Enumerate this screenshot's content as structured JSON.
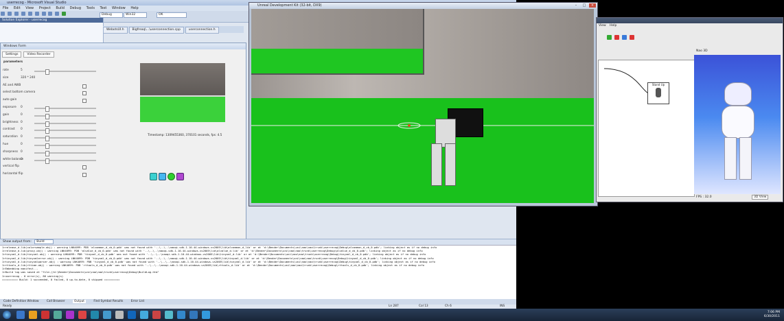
{
  "vs": {
    "title": "userrecog - Microsoft Visual Studio",
    "menu": [
      "File",
      "Edit",
      "View",
      "Project",
      "Build",
      "Debug",
      "Tools",
      "Test",
      "Window",
      "Help"
    ],
    "config": "Debug",
    "platform": "Win32",
    "find": "OK",
    "solution_title": "Solution Explorer - userrecog",
    "doc_tabs": [
      "WebotsUI.h",
      "Bigfreaq\\...\\userconnection.cpp",
      "userconnection.h"
    ]
  },
  "camera_dialog": {
    "title": "Windows Form",
    "tabs": [
      "Settings",
      "Video Recorder"
    ],
    "section_params": "parameters",
    "rows": [
      {
        "label": "rate",
        "value": "5"
      },
      {
        "label": "size",
        "value": "320 * 240"
      },
      {
        "label": "AE and AWB",
        "value": ""
      },
      {
        "label": "select bottom camera",
        "value": ""
      },
      {
        "label": "auto gain",
        "value": ""
      },
      {
        "label": "exposure",
        "value": "0"
      },
      {
        "label": "gain",
        "value": "0"
      },
      {
        "label": "brightness",
        "value": "0"
      },
      {
        "label": "contrast",
        "value": "0"
      },
      {
        "label": "saturation",
        "value": "0"
      },
      {
        "label": "hue",
        "value": "0"
      },
      {
        "label": "sharpness",
        "value": "0"
      },
      {
        "label": "white balance",
        "value": "0"
      },
      {
        "label": "vertical flip",
        "value": ""
      },
      {
        "label": "horizontal flip",
        "value": ""
      }
    ],
    "timestamp": "Timestamp: 1309455360, 370101 seconds, fps: 4.5"
  },
  "output": {
    "header_label": "Show output from:",
    "source": "Build",
    "lines": [
      "1>release_d.lib(colorsample.obj) : warning LNK4099: PDB 'alcommon_d_cb_0.pdb' was not found with '..\\..\\..\\naoqi-sdk-1.10.44-windows-vs2005\\lib\\alcommon_d_lib' or at 'd:\\Bender\\Documents\\uni\\nao\\nao\\trunk\\userrecog\\Debug\\alcommon_d_cb_0.pdb'; linking object as if no debug info",
      "1>release_d.lib(proxy.obj) : warning LNK4099: PDB 'alvalue_d_cb_0.pdb' was not found with '..\\..\\..\\naoqi-sdk-1.10.44-windows-vs2005\\lib\\alvalue_d.lib' or at 'd:\\Bender\\Documents\\uni\\nao\\nao\\trunk\\userrecog\\Debug\\alvalue_d_cb_0.pdb'; linking object as if no debug info",
      "1>tinyxml_d.lib(tinyxml.obj) : warning LNK4099: PDB 'tinyxml_d_cb_0.pdb' was not found with '..\\..\\..\\naoqi-sdk-1.10.44-windows-vs2005\\lib\\tinyxml_d.lib' or at 'd:\\Bender\\Documents\\uni\\nao\\nao\\trunk\\userrecog\\Debug\\tinyxml_d_cb_0.pdb'; linking object as if no debug info",
      "1>tinyxml_d.lib(tinyxmlerror.obj) : warning LNK4099: PDB 'tinyxml_d_cb_0.pdb' was not found with '..\\..\\..\\naoqi-sdk-1.10.44-windows-vs2005\\lib\\tinyxml_d.lib' or at 'd:\\Bender\\Documents\\uni\\nao\\nao\\trunk\\userrecog\\Debug\\tinyxml_d_cb_0.pdb'; linking object as if no debug info",
      "1>tinyxml_d.lib(tinyxmlparser.obj) : warning LNK4099: PDB 'tinyxml_d_cb_0.pdb' was not found with '..\\..\\..\\naoqi-sdk-1.10.44-windows-vs2005\\lib\\tinyxml_d.lib' or at 'd:\\Bender\\Documents\\uni\\nao\\nao\\trunk\\userrecog\\Debug\\tinyxml_d_cb_0.pdb'; linking object as if no debug info",
      "1>rttools_d.lib(rttime.obj) : warning LNK4099: PDB 'rttools_d_cb_0.pdb' was not found with '..\\..\\..\\naoqi-sdk-1.10.44-windows-vs2005\\lib\\rttools_d.lib' or at 'd:\\Bender\\Documents\\uni\\nao\\nao\\trunk\\userrecog\\Debug\\rttools_d_cb_0.pdb'; linking object as if no debug info",
      "1>Embedding manifest...",
      "1>Build log was saved at \"file://d:\\Bender\\Documents\\uni\\nao\\nao\\trunk\\userrecog\\Debug\\BuildLog.htm\"",
      "1>userrecog - 0 error(s), 86 warning(s)",
      "========== Build: 1 succeeded, 0 failed, 0 up-to-date, 0 skipped =========="
    ],
    "bottom_tabs": [
      "Code Definition Window",
      "Call Browser",
      "Output",
      "Find Symbol Results",
      "Error List"
    ]
  },
  "status": {
    "ready": "Ready",
    "ln": "Ln 287",
    "col": "Col 13",
    "ch": "Ch 6",
    "mode": "INS"
  },
  "unreal": {
    "title": "Unreal Development Kit (32-bit, DX9)"
  },
  "choregraphe": {
    "menu": [
      "View",
      "Help"
    ],
    "box_label": "Stand Up",
    "view_title": "Nao 3D",
    "fps": "FPS : 32.0",
    "view_mode": "3D View"
  },
  "taskbar": {
    "time": "7:06 PM",
    "date": "6/30/2011"
  },
  "colors": {
    "field": "#19c11c",
    "vs_accent": "#4d6a99"
  }
}
